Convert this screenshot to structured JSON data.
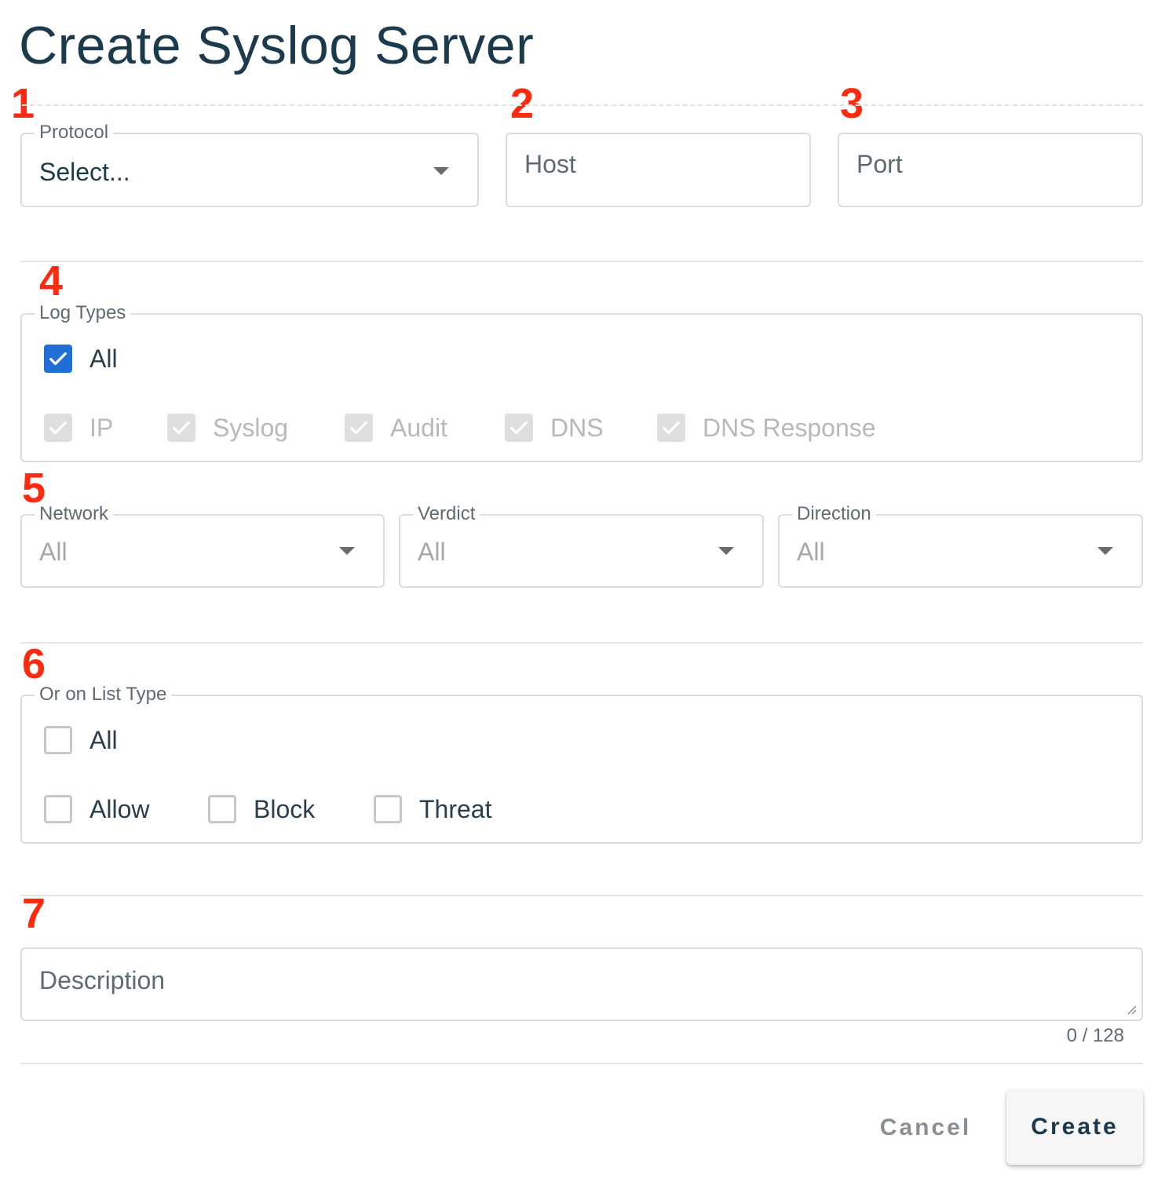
{
  "title": "Create Syslog Server",
  "markers": [
    "1",
    "2",
    "3",
    "4",
    "5",
    "6",
    "7"
  ],
  "protocol": {
    "label": "Protocol",
    "value": "Select..."
  },
  "host": {
    "placeholder": "Host"
  },
  "port": {
    "placeholder": "Port"
  },
  "log_types": {
    "label": "Log Types",
    "all": {
      "label": "All",
      "checked": true
    },
    "items": [
      {
        "label": "IP",
        "checked": true,
        "disabled": true
      },
      {
        "label": "Syslog",
        "checked": true,
        "disabled": true
      },
      {
        "label": "Audit",
        "checked": true,
        "disabled": true
      },
      {
        "label": "DNS",
        "checked": true,
        "disabled": true
      },
      {
        "label": "DNS Response",
        "checked": true,
        "disabled": true
      }
    ]
  },
  "filters": {
    "network": {
      "label": "Network",
      "value": "All"
    },
    "verdict": {
      "label": "Verdict",
      "value": "All"
    },
    "direction": {
      "label": "Direction",
      "value": "All"
    }
  },
  "list_type": {
    "label": "Or on List Type",
    "all": {
      "label": "All",
      "checked": false
    },
    "items": [
      {
        "label": "Allow",
        "checked": false
      },
      {
        "label": "Block",
        "checked": false
      },
      {
        "label": "Threat",
        "checked": false
      }
    ]
  },
  "description": {
    "placeholder": "Description",
    "counter": "0 / 128"
  },
  "actions": {
    "cancel": "Cancel",
    "create": "Create"
  },
  "colors": {
    "accent": "#1f6fd6",
    "marker": "#ff2a0f",
    "title": "#1b3a4c"
  }
}
